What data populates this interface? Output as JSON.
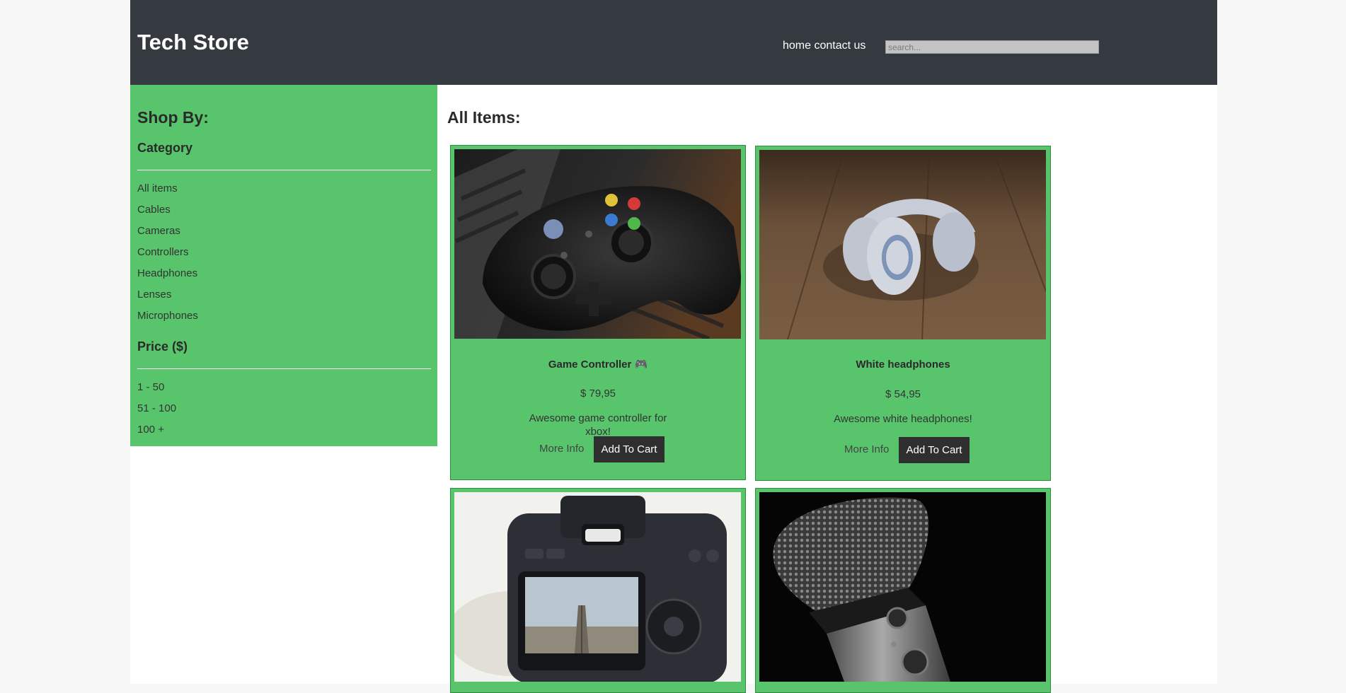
{
  "header": {
    "logo": "Tech Store",
    "nav": [
      {
        "label": "home"
      },
      {
        "label": "contact us"
      }
    ],
    "search_placeholder": "search..."
  },
  "sidebar": {
    "heading": "Shop By:",
    "category_heading": "Category",
    "categories": [
      {
        "label": "All items"
      },
      {
        "label": "Cables"
      },
      {
        "label": "Cameras"
      },
      {
        "label": "Controllers"
      },
      {
        "label": "Headphones"
      },
      {
        "label": "Lenses"
      },
      {
        "label": "Microphones"
      }
    ],
    "price_heading": "Price ($)",
    "prices": [
      {
        "label": "1 - 50"
      },
      {
        "label": "51 - 100"
      },
      {
        "label": "100 +"
      }
    ]
  },
  "main": {
    "title": "All Items:",
    "products": [
      {
        "name": "Game Controller 🎮",
        "price": "$ 79,95",
        "description": "Awesome game controller for xbox!",
        "more_info": "More Info",
        "add_to_cart": "Add To Cart",
        "image": "game-controller-photo"
      },
      {
        "name": "White headphones",
        "price": "$ 54,95",
        "description": "Awesome white headphones!",
        "more_info": "More Info",
        "add_to_cart": "Add To Cart",
        "image": "headphones-photo"
      },
      {
        "image": "camera-photo"
      },
      {
        "image": "microphone-photo"
      }
    ]
  },
  "colors": {
    "header_bg": "#343a40",
    "accent_green": "#58c56c",
    "button_dark": "#2f2f2f"
  }
}
